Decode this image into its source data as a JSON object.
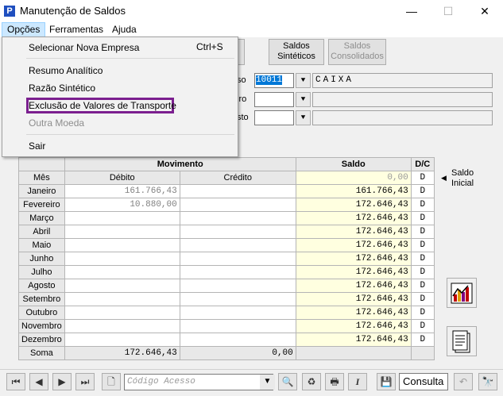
{
  "window": {
    "title": "Manutenção de Saldos",
    "icon_letter": "P"
  },
  "menubar": {
    "items": [
      "Opções",
      "Ferramentas",
      "Ajuda"
    ]
  },
  "dropdown": {
    "items": [
      {
        "label": "Selecionar Nova Empresa",
        "shortcut": "Ctrl+S"
      },
      {
        "label": "Resumo Analítico"
      },
      {
        "label": "Razão Sintético"
      },
      {
        "label": "Exclusão de Valores de Transporte"
      },
      {
        "label": "Outra Moeda"
      },
      {
        "label": "Sair"
      }
    ]
  },
  "buttons": {
    "saldos_sinteticos": "Saldos\nSintéticos",
    "saldos_consolidados": "Saldos\nConsolidados"
  },
  "fields": {
    "label1": "so",
    "value1": "10011",
    "desc1": "CAIXA",
    "label2": "iro",
    "label3": "sto"
  },
  "table": {
    "group_movimento": "Movimento",
    "group_saldo": "Saldo",
    "group_dc": "D/C",
    "col_mes": "Mês",
    "col_debito": "Débito",
    "col_credito": "Crédito",
    "opening_saldo": "0,00",
    "opening_dc": "D",
    "rows": [
      {
        "mes": "Janeiro",
        "debito": "161.766,43",
        "credito": "",
        "saldo": "161.766,43",
        "dc": "D"
      },
      {
        "mes": "Fevereiro",
        "debito": "10.880,00",
        "credito": "",
        "saldo": "172.646,43",
        "dc": "D"
      },
      {
        "mes": "Março",
        "debito": "",
        "credito": "",
        "saldo": "172.646,43",
        "dc": "D"
      },
      {
        "mes": "Abril",
        "debito": "",
        "credito": "",
        "saldo": "172.646,43",
        "dc": "D"
      },
      {
        "mes": "Maio",
        "debito": "",
        "credito": "",
        "saldo": "172.646,43",
        "dc": "D"
      },
      {
        "mes": "Junho",
        "debito": "",
        "credito": "",
        "saldo": "172.646,43",
        "dc": "D"
      },
      {
        "mes": "Julho",
        "debito": "",
        "credito": "",
        "saldo": "172.646,43",
        "dc": "D"
      },
      {
        "mes": "Agosto",
        "debito": "",
        "credito": "",
        "saldo": "172.646,43",
        "dc": "D"
      },
      {
        "mes": "Setembro",
        "debito": "",
        "credito": "",
        "saldo": "172.646,43",
        "dc": "D"
      },
      {
        "mes": "Outubro",
        "debito": "",
        "credito": "",
        "saldo": "172.646,43",
        "dc": "D"
      },
      {
        "mes": "Novembro",
        "debito": "",
        "credito": "",
        "saldo": "172.646,43",
        "dc": "D"
      },
      {
        "mes": "Dezembro",
        "debito": "",
        "credito": "",
        "saldo": "172.646,43",
        "dc": "D"
      }
    ],
    "soma_label": "Soma",
    "soma_debito": "172.646,43",
    "soma_credito": "0,00"
  },
  "saldo_inicial_label": "Saldo\nInicial",
  "bottombar": {
    "code_placeholder": "Código Acesso",
    "status": "Consulta"
  },
  "colors": {
    "selection": "#0078d7",
    "highlight_border": "#7b1f8f",
    "saldo_bg": "#ffffe0"
  }
}
